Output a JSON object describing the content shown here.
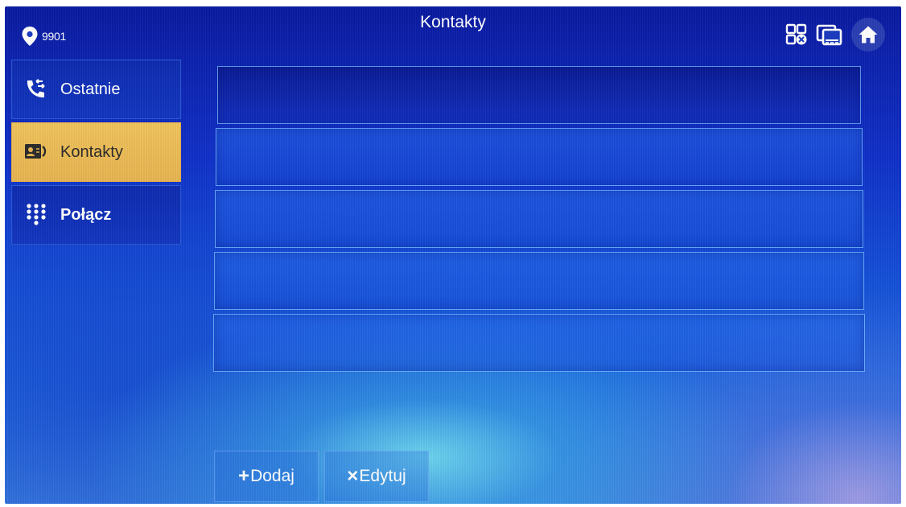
{
  "header": {
    "location_code": "9901",
    "title": "Kontakty"
  },
  "sidebar": {
    "items": [
      {
        "label": "Ostatnie",
        "icon": "phone-log-icon",
        "active": false
      },
      {
        "label": "Kontakty",
        "icon": "contact-card-icon",
        "active": true
      },
      {
        "label": "Połącz",
        "icon": "dialpad-icon",
        "active": false
      }
    ]
  },
  "contacts": {
    "rows": [
      "",
      "",
      "",
      "",
      ""
    ]
  },
  "actions": {
    "add_symbol": "+",
    "add_label": "Dodaj",
    "edit_symbol": "×",
    "edit_label": "Edytuj"
  },
  "colors": {
    "active_tab": "#e7b451",
    "background": "#1336c0"
  }
}
